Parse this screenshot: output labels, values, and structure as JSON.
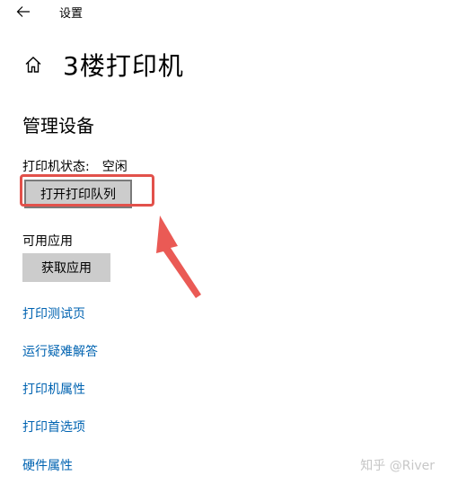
{
  "window": {
    "title": "设置"
  },
  "header": {
    "title": "3楼打印机"
  },
  "manage": {
    "section_title": "管理设备",
    "status_label": "打印机状态:",
    "status_value": "空闲",
    "open_queue_button": "打开打印队列"
  },
  "apps": {
    "label": "可用应用",
    "get_app_button": "获取应用"
  },
  "links": [
    {
      "label": "打印测试页"
    },
    {
      "label": "运行疑难解答"
    },
    {
      "label": "打印机属性"
    },
    {
      "label": "打印首选项"
    },
    {
      "label": "硬件属性"
    }
  ],
  "watermark": "知乎 @River",
  "colors": {
    "link": "#0063b1",
    "button_bg": "#cccccc",
    "highlight": "#e2514b"
  },
  "icons": {
    "back": "back-arrow-icon",
    "home": "home-icon"
  }
}
